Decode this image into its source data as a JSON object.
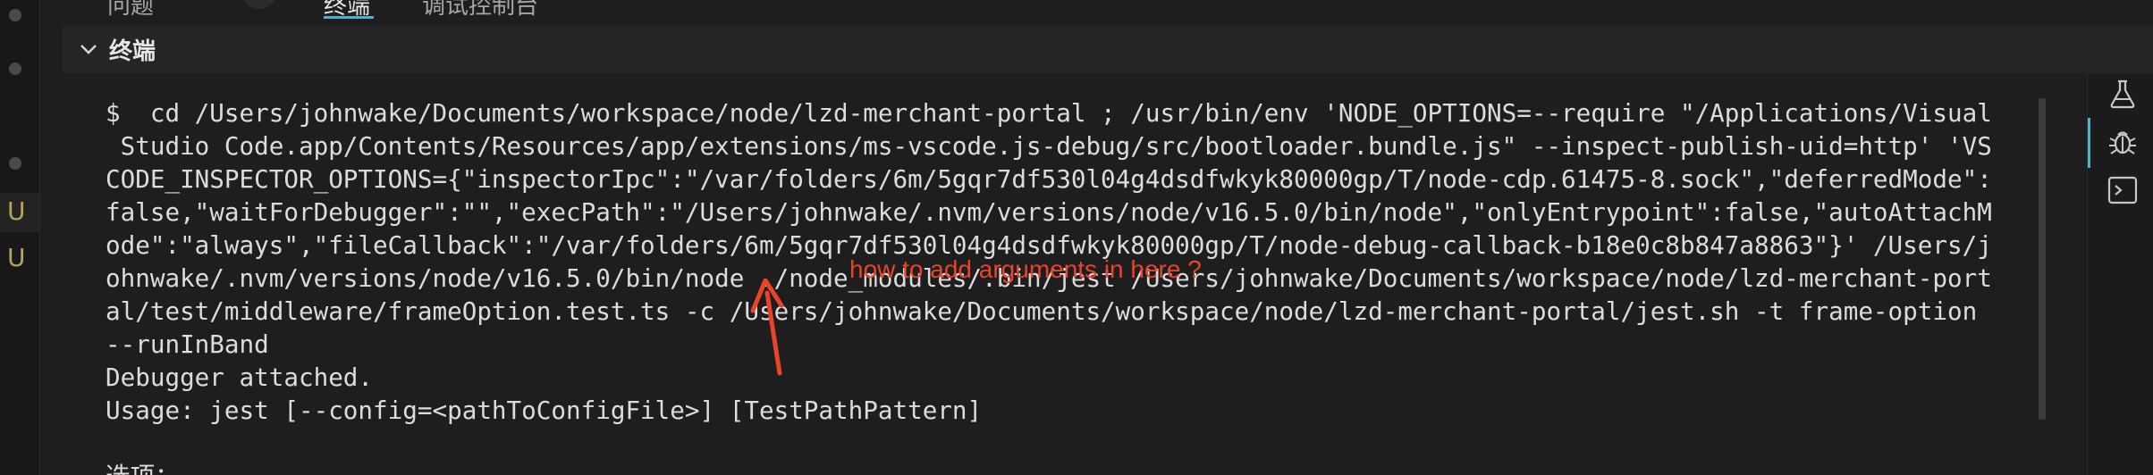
{
  "top_tabs": [
    "问题",
    "终端",
    "调试控制台"
  ],
  "panel": {
    "title": "终端"
  },
  "terminal": {
    "lines": [
      "$  cd /Users/johnwake/Documents/workspace/node/lzd-merchant-portal ; /usr/bin/env 'NODE_OPTIONS=--require \"/Applications/Visual",
      " Studio Code.app/Contents/Resources/app/extensions/ms-vscode.js-debug/src/bootloader.bundle.js\" --inspect-publish-uid=http' 'VS",
      "CODE_INSPECTOR_OPTIONS={\"inspectorIpc\":\"/var/folders/6m/5gqr7df530l04g4dsdfwkyk80000gp/T/node-cdp.61475-8.sock\",\"deferredMode\":",
      "false,\"waitForDebugger\":\"\",\"execPath\":\"/Users/johnwake/.nvm/versions/node/v16.5.0/bin/node\",\"onlyEntrypoint\":false,\"autoAttachM",
      "ode\":\"always\",\"fileCallback\":\"/var/folders/6m/5gqr7df530l04g4dsdfwkyk80000gp/T/node-debug-callback-b18e0c8b847a8863\"}' /Users/j",
      "ohnwake/.nvm/versions/node/v16.5.0/bin/node ./node_modules/.bin/jest /Users/johnwake/Documents/workspace/node/lzd-merchant-port",
      "al/test/middleware/frameOption.test.ts -c /Users/johnwake/Documents/workspace/node/lzd-merchant-portal/jest.sh -t frame-option",
      "--runInBand",
      "Debugger attached.",
      "Usage: jest [--config=<pathToConfigFile>] [TestPathPattern]",
      "",
      "选项："
    ]
  },
  "annotation": {
    "text": "how to add arguments in here ?",
    "color": "#e8442b"
  },
  "gutter": {
    "git_markers": [
      "U",
      "U"
    ]
  },
  "right_toolbar": {
    "icons": [
      "beaker-icon",
      "bug-icon",
      "terminal-icon"
    ],
    "active": "bug-icon"
  },
  "colors": {
    "background": "#1e1e1e",
    "header": "#252526",
    "text": "#dcdcdc",
    "accent": "#4fb0c6",
    "git_untracked": "#b7a35a"
  }
}
